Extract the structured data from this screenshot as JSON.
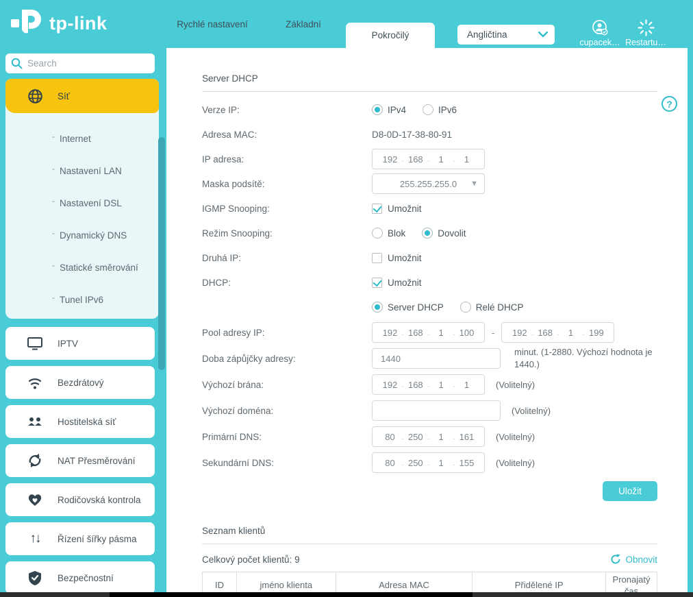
{
  "header": {
    "logo_text": "tp-link",
    "tabs": {
      "quick": "Rychlé nastavení",
      "basic": "Základní",
      "advanced": "Pokročilý"
    },
    "language": {
      "value": "Angličtina"
    },
    "account": {
      "label": "cupacek…"
    },
    "reboot": {
      "label": "Restartu…"
    }
  },
  "sidebar": {
    "search_placeholder": "Search",
    "submenu_bullet": "-",
    "active_item": {
      "label": "Síť"
    },
    "submenu": [
      "Internet",
      "Nastavení LAN",
      "Nastavení DSL",
      "Dynamický DNS",
      "Statické směrování",
      "Tunel IPv6"
    ],
    "items": [
      "IPTV",
      "Bezdrátový",
      "Hostitelská síť",
      "NAT Přesměrování",
      "Rodičovská kontrola",
      "Řízení šířky pásma",
      "Bezpečnostní"
    ]
  },
  "main": {
    "section_title": "Server DHCP",
    "help_glyph": "?",
    "form": {
      "octet_separator": ".",
      "verze_ip": {
        "label": "Verze IP:",
        "options": [
          "IPv4",
          "IPv6"
        ],
        "selected": "IPv4"
      },
      "mac": {
        "label": "Adresa MAC:",
        "value": "D8-0D-17-38-80-91"
      },
      "ip": {
        "label": "IP adresa:",
        "octets": [
          "192",
          "168",
          "1",
          "1"
        ]
      },
      "mask": {
        "label": "Maska podsítě:",
        "value": "255.255.255.0",
        "dropdown_glyph": "▼"
      },
      "igmp": {
        "label": "IGMP Snooping:",
        "checkbox_label": "Umožnit",
        "checked": true
      },
      "snoop_mode": {
        "label": "Režim Snooping:",
        "options": [
          "Blok",
          "Dovolit"
        ],
        "selected": "Dovolit"
      },
      "second_ip": {
        "label": "Druhá IP:",
        "checkbox_label": "Umožnit",
        "checked": false
      },
      "dhcp": {
        "label": "DHCP:",
        "checkbox_label": "Umožnit",
        "checked": true
      },
      "dhcp_mode": {
        "options": [
          "Server DHCP",
          "Relé DHCP"
        ],
        "selected": "Server DHCP"
      },
      "pool": {
        "label": "Pool adresy IP:",
        "from": [
          "192",
          "168",
          "1",
          "100"
        ],
        "to": [
          "192",
          "168",
          "1",
          "199"
        ],
        "separator": "-"
      },
      "lease": {
        "label": "Doba zápůjčky adresy:",
        "value": "1440",
        "note": "minut. (1-2880. Výchozí hodnota je 1440.)"
      },
      "gateway": {
        "label": "Výchozí brána:",
        "octets": [
          "192",
          "168",
          "1",
          "1"
        ],
        "note": "(Volitelný)"
      },
      "domain": {
        "label": "Výchozí doména:",
        "value": "",
        "note": "(Volitelný)"
      },
      "dns1": {
        "label": "Primární DNS:",
        "octets": [
          "80",
          "250",
          "1",
          "161"
        ],
        "note": "(Volitelný)"
      },
      "dns2": {
        "label": "Sekundární DNS:",
        "octets": [
          "80",
          "250",
          "1",
          "155"
        ],
        "note": "(Volitelný)"
      }
    },
    "save_label": "Uložit",
    "clients": {
      "title": "Seznam klientů",
      "total": "Celkový počet klientů: 9",
      "refresh_label": "Obnovit",
      "columns": [
        "ID",
        "jméno klienta",
        "Adresa MAC",
        "Přidělené IP",
        "Pronajatý čas"
      ]
    }
  },
  "colors": {
    "brand_teal": "#4accd7",
    "accent_teal": "#2fbccb",
    "active_yellow": "#f6c30e",
    "submenu_bg": "#e9f7f8",
    "scrollbar_dark": "#000000"
  }
}
